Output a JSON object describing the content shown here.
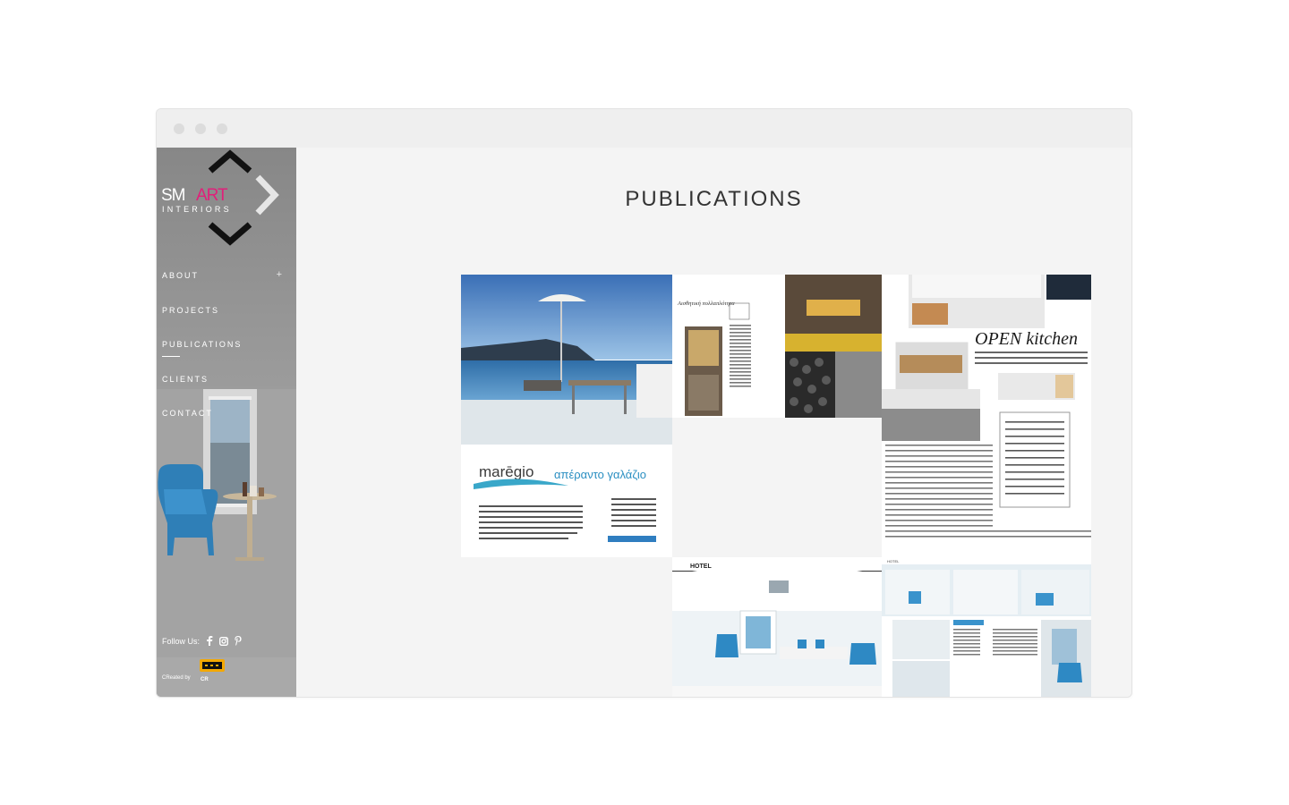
{
  "window": {
    "controls": [
      "close",
      "minimize",
      "maximize"
    ]
  },
  "brand": {
    "logo_prefix": "SM",
    "logo_accent": "ART",
    "logo_sub": "INTERIORS",
    "accent_color": "#e0207a"
  },
  "sidebar": {
    "nav": [
      {
        "label": "ABOUT",
        "expand": "+"
      },
      {
        "label": "PROJECTS"
      },
      {
        "label": "PUBLICATIONS",
        "active": true
      },
      {
        "label": "CLIENTS"
      },
      {
        "label": "CONTACT"
      }
    ],
    "follow_label": "Follow Us:",
    "social_icons": [
      "facebook-icon",
      "instagram-icon",
      "pinterest-icon"
    ],
    "created_by": "CReated by",
    "creator_logo": "CR"
  },
  "main": {
    "title": "PUBLICATIONS",
    "publications": [
      {
        "brand": "marēgio",
        "tagline": "απέραντο γαλάζιο"
      },
      {
        "heading": "Αισθητική πολλαπλότητα"
      },
      {
        "heading": "OPEN kitchen"
      },
      {
        "label": "HOTEL"
      },
      {
        "label": "HOTEL"
      }
    ]
  }
}
